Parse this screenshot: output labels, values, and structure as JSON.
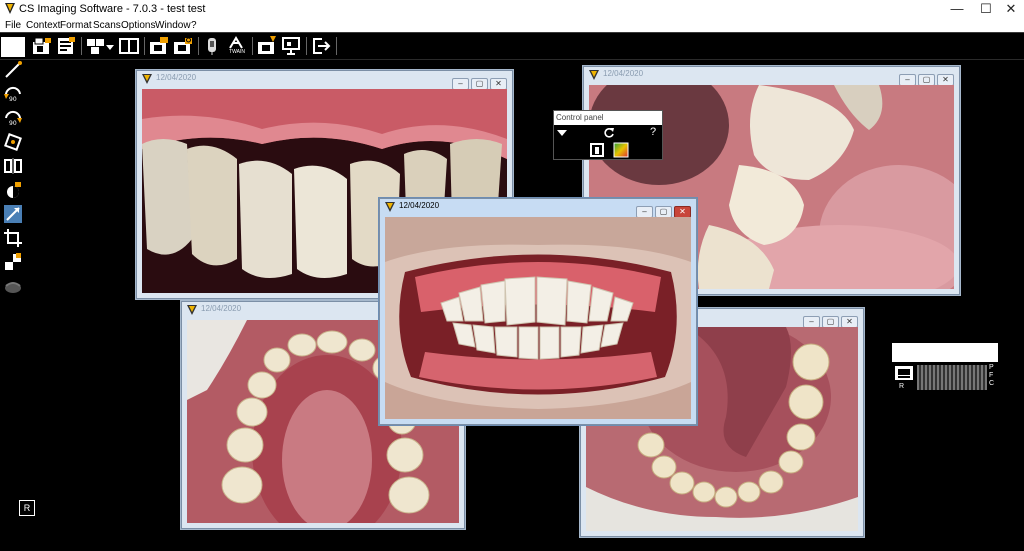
{
  "window": {
    "title": "CS Imaging Software - 7.0.3 - test test",
    "minimize_glyph": "—",
    "maximize_glyph": "☐",
    "close_glyph": "✕"
  },
  "menu": [
    "File",
    "Context",
    "Format",
    "Scans",
    "Options",
    "Window",
    "?"
  ],
  "toolbar": {
    "icons": [
      "open-study-icon",
      "report-icon",
      "layout-icon",
      "dropdown-icon",
      "compare-icon",
      "export-icon",
      "lock-icon",
      "sensor-icon",
      "twain-icon",
      "acquire-icon",
      "present-icon",
      "exit-icon"
    ],
    "twain_label": "TWAIN"
  },
  "left_tools": [
    "measure-icon",
    "rotate-left-90-icon",
    "rotate-right-90-icon",
    "rotate-icon",
    "flip-icon",
    "contrast-icon",
    "zoom-icon",
    "crop-icon",
    "filter-icon",
    "tooth-icon"
  ],
  "image_windows": [
    {
      "id": "maxillary-anterior",
      "date": "12/04/2020",
      "active": false
    },
    {
      "id": "left-buccal",
      "date": "12/04/2020",
      "active": false
    },
    {
      "id": "upper-occlusal",
      "date": "12/04/2020",
      "active": false
    },
    {
      "id": "lower-occlusal",
      "date": "",
      "active": false
    },
    {
      "id": "frontal-smile",
      "date": "12/04/2020",
      "active": true
    }
  ],
  "control_panel": {
    "title": "Control panel",
    "help": "?"
  },
  "thumb_panel": {
    "letters": [
      "P",
      "F",
      "C"
    ],
    "label": "R"
  },
  "corner_badge": "R",
  "colors": {
    "desktop": "#000000",
    "window_frame": "#dce6f1",
    "close_red": "#c8453a",
    "gum_pink": "#c96b6e",
    "tooth": "#f1ece2"
  }
}
